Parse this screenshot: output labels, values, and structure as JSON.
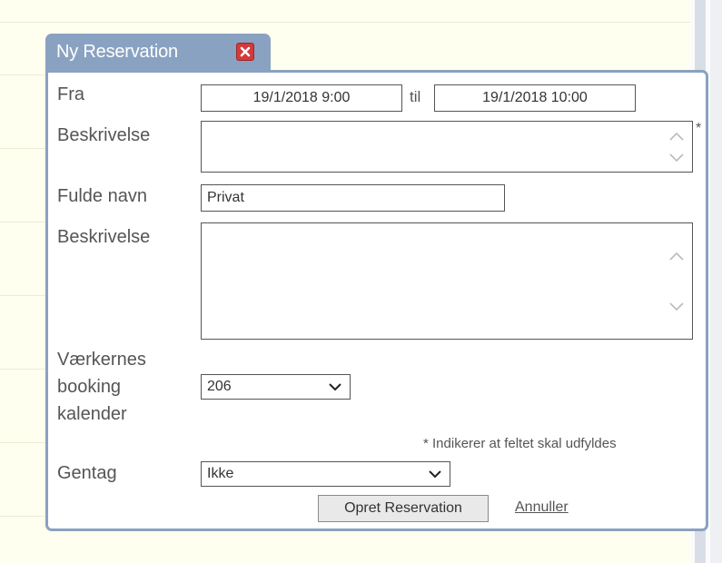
{
  "dialog": {
    "title": "Ny Reservation",
    "close_icon": "close-icon",
    "from_label": "Fra",
    "from_value": "19/1/2018  9:00",
    "to_label": "til",
    "to_value": "19/1/2018  10:00",
    "description1_label": "Beskrivelse",
    "description1_value": "",
    "required_star": "*",
    "full_name_label": "Fulde navn",
    "full_name_value": "Privat",
    "description2_label": "Beskrivelse",
    "description2_value": "",
    "calendar_label_line1": "Værkernes",
    "calendar_label_line2": "booking",
    "calendar_label_line3": "kalender",
    "calendar_selected": "206",
    "required_hint": "* Indikerer at feltet skal udfyldes",
    "repeat_label": "Gentag",
    "repeat_selected": "Ikke",
    "submit_label": "Opret Reservation",
    "cancel_label": "Annuller"
  },
  "colors": {
    "dialog_border": "#8aa2c1",
    "close_button": "#d23b3b",
    "page_background": "#fffff0"
  }
}
